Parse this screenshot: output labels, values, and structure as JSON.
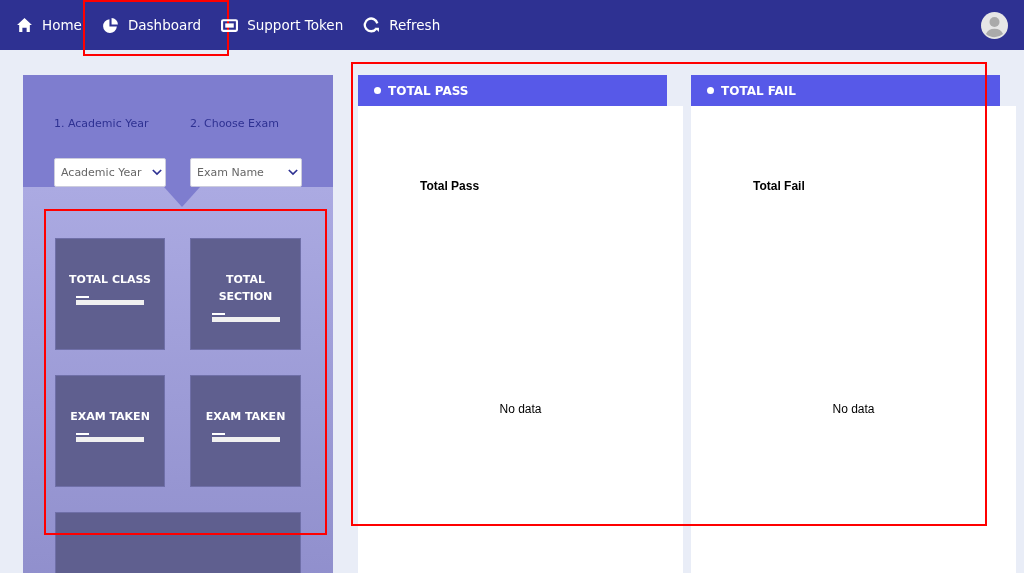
{
  "nav": {
    "items": [
      {
        "label": "Home",
        "highlighted": false
      },
      {
        "label": "Dashboard",
        "highlighted": true
      },
      {
        "label": "Support Token",
        "highlighted": false
      },
      {
        "label": "Refresh",
        "highlighted": false
      }
    ]
  },
  "filters": [
    {
      "label": "1. Academic Year",
      "placeholder": "Academic Year"
    },
    {
      "label": "2. Choose Exam",
      "placeholder": "Exam Name"
    }
  ],
  "tiles_highlighted": true,
  "tiles": [
    {
      "kind": "stat",
      "title": "TOTAL CLASS"
    },
    {
      "kind": "stat",
      "title": "TOTAL SECTION"
    },
    {
      "kind": "stat",
      "title": "EXAM TAKEN"
    },
    {
      "kind": "stat",
      "title": "EXAM TAKEN"
    },
    {
      "kind": "partial"
    }
  ],
  "cards_highlighted": true,
  "cards": [
    {
      "header": "TOTAL PASS",
      "chart_title": "Total Pass",
      "empty_text": "No data"
    },
    {
      "header": "TOTAL FAIL",
      "chart_title": "Total Fail",
      "empty_text": "No data"
    }
  ]
}
